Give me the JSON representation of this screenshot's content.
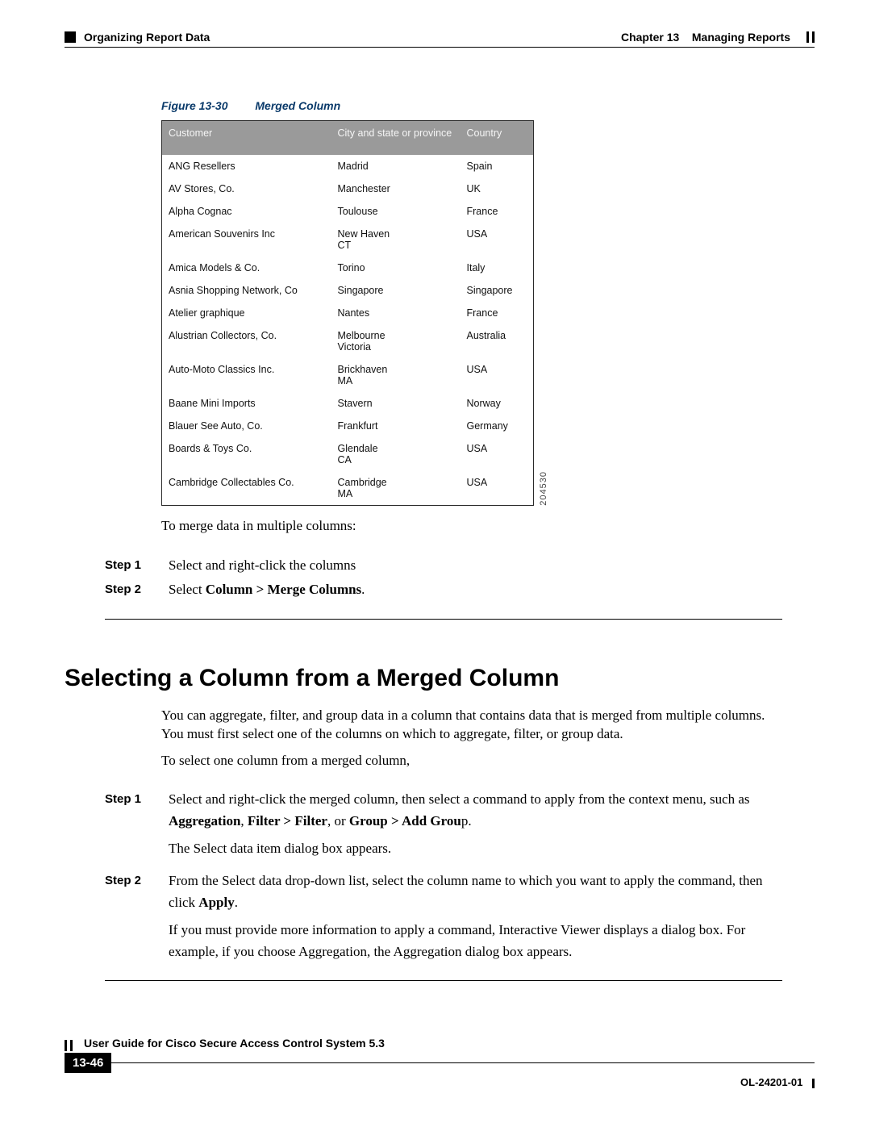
{
  "header": {
    "section_left": "Organizing Report Data",
    "chapter_label": "Chapter 13",
    "chapter_title": "Managing Reports"
  },
  "figure": {
    "label": "Figure 13-30",
    "title": "Merged Column",
    "id_label": "204530",
    "columns": [
      "Customer",
      "City and state or province",
      "Country"
    ],
    "rows": [
      {
        "c0": "ANG Resellers",
        "c1": "Madrid",
        "c1b": "",
        "c2": "Spain"
      },
      {
        "c0": "AV Stores, Co.",
        "c1": "Manchester",
        "c1b": "",
        "c2": "UK"
      },
      {
        "c0": "Alpha Cognac",
        "c1": "Toulouse",
        "c1b": "",
        "c2": "France"
      },
      {
        "c0": "American Souvenirs Inc",
        "c1": "New Haven",
        "c1b": "CT",
        "c2": "USA"
      },
      {
        "c0": "Amica Models & Co.",
        "c1": "Torino",
        "c1b": "",
        "c2": "Italy"
      },
      {
        "c0": "Asnia Shopping Network, Co",
        "c1": "Singapore",
        "c1b": "",
        "c2": "Singapore"
      },
      {
        "c0": "Atelier graphique",
        "c1": "Nantes",
        "c1b": "",
        "c2": "France"
      },
      {
        "c0": "Alustrian Collectors, Co.",
        "c1": "Melbourne",
        "c1b": "Victoria",
        "c2": "Australia"
      },
      {
        "c0": "Auto-Moto Classics Inc.",
        "c1": "Brickhaven",
        "c1b": "MA",
        "c2": "USA"
      },
      {
        "c0": "Baane Mini Imports",
        "c1": "Stavern",
        "c1b": "",
        "c2": "Norway"
      },
      {
        "c0": "Blauer See Auto, Co.",
        "c1": "Frankfurt",
        "c1b": "",
        "c2": "Germany"
      },
      {
        "c0": "Boards & Toys Co.",
        "c1": "Glendale",
        "c1b": "CA",
        "c2": "USA"
      },
      {
        "c0": "Cambridge Collectables Co.",
        "c1": "Cambridge",
        "c1b": "MA",
        "c2": "USA"
      }
    ]
  },
  "intro1": "To merge data in multiple columns:",
  "steps1": {
    "s1_label": "Step 1",
    "s1_text": "Select and right-click the columns",
    "s2_label": "Step 2",
    "s2_prefix": "Select ",
    "s2_bold": "Column > Merge Columns",
    "s2_suffix": "."
  },
  "h2": "Selecting a Column from a Merged Column",
  "para2a": "You can aggregate, filter, and group data in a column that contains data that is merged from multiple columns. You must first select one of the columns on which to aggregate, filter, or group data.",
  "para2b": "To select one column from a merged column,",
  "steps2": {
    "s1_label": "Step 1",
    "s1_a": "Select and right-click the merged column, then select a command to apply from the context menu, such as ",
    "s1_b1": "Aggregation",
    "s1_m1": ", ",
    "s1_b2": "Filter > Filter",
    "s1_m2": ", or ",
    "s1_b3": "Group > Add Grou",
    "s1_p": "p.",
    "s1_c": "The Select data item dialog box appears.",
    "s2_label": "Step 2",
    "s2_a": "From the Select data drop-down list, select the column name to which you want to apply the command, then click ",
    "s2_b": "Apply",
    "s2_p": ".",
    "s2_c": "If you must provide more information to apply a command, Interactive Viewer displays a dialog box. For example, if you choose Aggregation, the Aggregation dialog box appears."
  },
  "footer": {
    "guide": "User Guide for Cisco Secure Access Control System 5.3",
    "page": "13-46",
    "ol": "OL-24201-01"
  }
}
